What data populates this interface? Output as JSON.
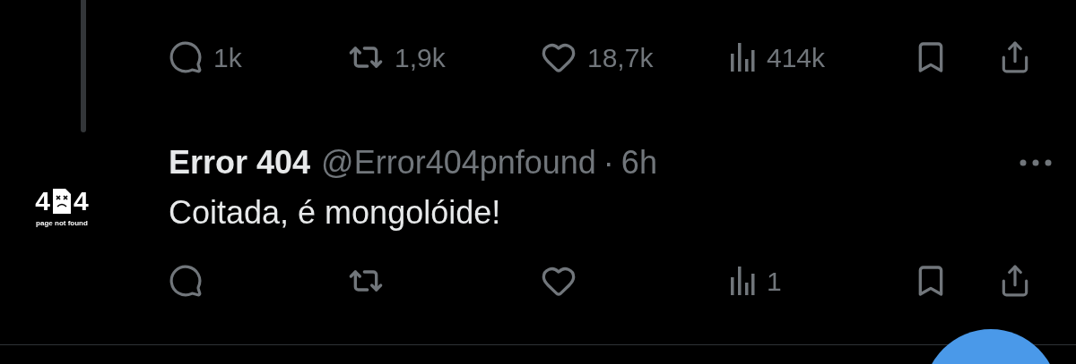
{
  "previous_tweet": {
    "actions": [
      {
        "kind": "reply",
        "count": "1k"
      },
      {
        "kind": "retweet",
        "count": "1,9k"
      },
      {
        "kind": "like",
        "count": "18,7k"
      },
      {
        "kind": "views",
        "count": "414k"
      },
      {
        "kind": "bookmark"
      },
      {
        "kind": "share"
      }
    ]
  },
  "reply_tweet": {
    "avatar": {
      "left_digit": "4",
      "right_digit": "4",
      "caption": "page not found"
    },
    "name": "Error 404",
    "handle": "@Error404pnfound",
    "separator": "·",
    "time": "6h",
    "text": "Coitada, é mongolóide!",
    "actions": [
      {
        "kind": "reply"
      },
      {
        "kind": "retweet"
      },
      {
        "kind": "like"
      },
      {
        "kind": "views",
        "count": "1"
      },
      {
        "kind": "bookmark"
      },
      {
        "kind": "share"
      }
    ]
  }
}
